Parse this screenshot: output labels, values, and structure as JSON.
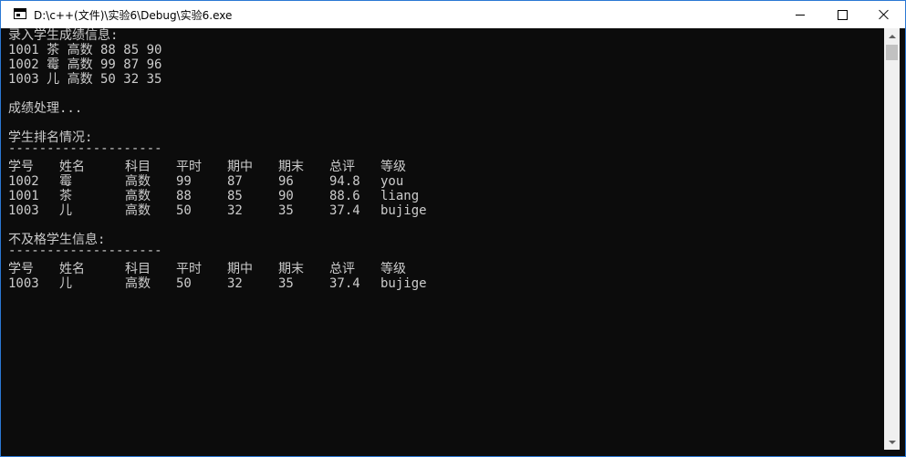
{
  "window": {
    "title": "D:\\c++(文件)\\实验6\\Debug\\实验6.exe",
    "accent": "#2b78d4",
    "console_bg": "#0c0c0c",
    "console_fg": "#cccccc"
  },
  "controls": {
    "minimize": "minimize-icon",
    "maximize": "maximize-icon",
    "close": "close-icon"
  },
  "console": {
    "input_header": "录入学生成绩信息:",
    "input_lines": [
      "1001 茶 高数 88 85 90",
      "1002 霉 高数 99 87 96",
      "1003 儿 高数 50 32 35"
    ],
    "processing": "成绩处理...",
    "ranking": {
      "title": "学生排名情况:",
      "divider": "--------------------",
      "headers": [
        "学号",
        "姓名",
        "科目",
        "平时",
        "期中",
        "期末",
        "总评",
        "等级"
      ],
      "rows": [
        [
          "1002",
          "霉",
          "高数",
          "99",
          "87",
          "96",
          "94.8",
          "you"
        ],
        [
          "1001",
          "茶",
          "高数",
          "88",
          "85",
          "90",
          "88.6",
          "liang"
        ],
        [
          "1003",
          "儿",
          "高数",
          "50",
          "32",
          "35",
          "37.4",
          "bujige"
        ]
      ]
    },
    "failing": {
      "title": "不及格学生信息:",
      "divider": "--------------------",
      "headers": [
        "学号",
        "姓名",
        "科目",
        "平时",
        "期中",
        "期末",
        "总评",
        "等级"
      ],
      "rows": [
        [
          "1003",
          "儿",
          "高数",
          "50",
          "32",
          "35",
          "37.4",
          "bujige"
        ]
      ]
    }
  }
}
